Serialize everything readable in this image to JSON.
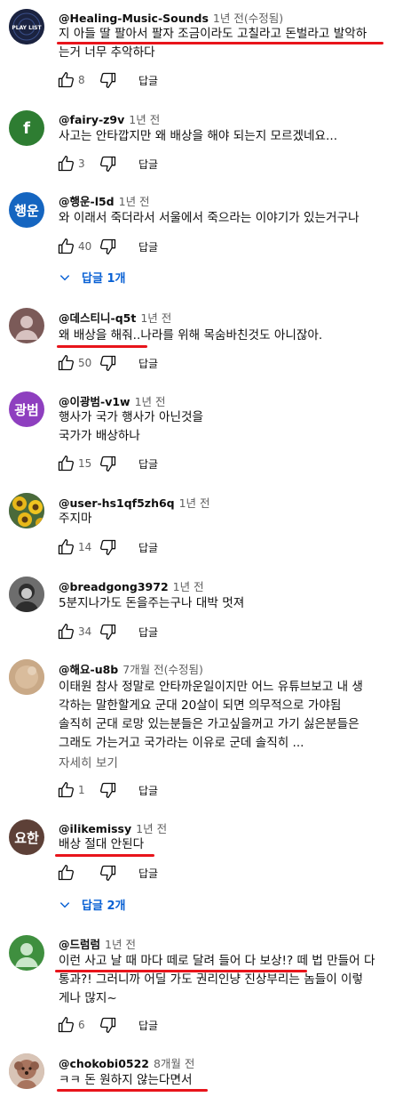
{
  "labels": {
    "reply": "답글",
    "read_more": "자세히 보기"
  },
  "comments": [
    {
      "author": "@Healing-Music-Sounds",
      "time": "1년 전(수정됨)",
      "lines": [
        "지 아들 딸 팔아서 팔자 조금이라도 고칠라고 돈벌라고 발악하",
        "는거 너무 추악하다"
      ],
      "likes": "8",
      "avatar_text": "PLAY LIST",
      "avatar_color": "#1b2340"
    },
    {
      "author": "@fairy-z9v",
      "time": "1년 전",
      "lines": [
        "사고는 안타깝지만 왜 배상을 해야 되는지 모르겠네요..."
      ],
      "likes": "3",
      "avatar_text": "f",
      "avatar_color": "#2e7d32"
    },
    {
      "author": "@행운-l5d",
      "time": "1년 전",
      "lines": [
        "와 이래서 죽더라서 서울에서 죽으라는 이야기가 있는거구나"
      ],
      "likes": "40",
      "avatar_text": "행운",
      "avatar_color": "#1565c0",
      "replies": "답글 1개"
    },
    {
      "author": "@데스티니-q5t",
      "time": "1년 전",
      "lines": [
        "왜 배상을 해줘..나라를 위해 목숨바친것도 아니잖아."
      ],
      "likes": "50",
      "avatar_text": "",
      "avatar_color": "#7b5a58"
    },
    {
      "author": "@이광범-v1w",
      "time": "1년 전",
      "lines": [
        "행사가 국가 행사가 아닌것을",
        "국가가 배상하나"
      ],
      "likes": "15",
      "avatar_text": "광범",
      "avatar_color": "#8e3fbf"
    },
    {
      "author": "@user-hs1qf5zh6q",
      "time": "1년 전",
      "lines": [
        "주지마"
      ],
      "likes": "14",
      "avatar_text": "",
      "avatar_color": "#5a6f8e"
    },
    {
      "author": "@breadgong3972",
      "time": "1년 전",
      "lines": [
        "5분지나가도 돈을주는구나 대박 멋져"
      ],
      "likes": "34",
      "avatar_text": "",
      "avatar_color": "#8a8a8a"
    },
    {
      "author": "@해요-u8b",
      "time": "7개월 전(수정됨)",
      "lines": [
        "이태원 참사 정말로 안타까운일이지만 어느 유튜브보고 내 생",
        "각하는 말한할게요 군대 20살이 되면 의무적으로 가야됨",
        "솔직히 군대 로망 있는분들은 가고싶을꺼고 가기 싫은분들은",
        "그래도 가는거고 국가라는 이유로 군데 솔직히 ..."
      ],
      "likes": "1",
      "avatar_text": "",
      "avatar_color": "#c9a987",
      "read_more": true
    },
    {
      "author": "@ilikemissy",
      "time": "1년 전",
      "lines": [
        "배상 절대 안된다"
      ],
      "likes": "",
      "avatar_text": "요한",
      "avatar_color": "#5d4037",
      "replies": "답글 2개"
    },
    {
      "author": "@드럼럼",
      "time": "1년 전",
      "lines": [
        "이런 사고 날 때 마다 떼로 달려 들어 다 보상!? 떼 법 만들어 다",
        "통과?! 그러니까 어딜 가도 권리인냥 진상부리는 놈들이 이렇",
        "게나 많지~"
      ],
      "likes": "6",
      "avatar_text": "",
      "avatar_color": "#3f8f3f"
    },
    {
      "author": "@chokobi0522",
      "time": "8개월 전",
      "lines": [
        "ㅋㅋ 돈 원하지 않는다면서"
      ],
      "likes": "",
      "avatar_text": "",
      "avatar_color": "#b08a78"
    }
  ]
}
